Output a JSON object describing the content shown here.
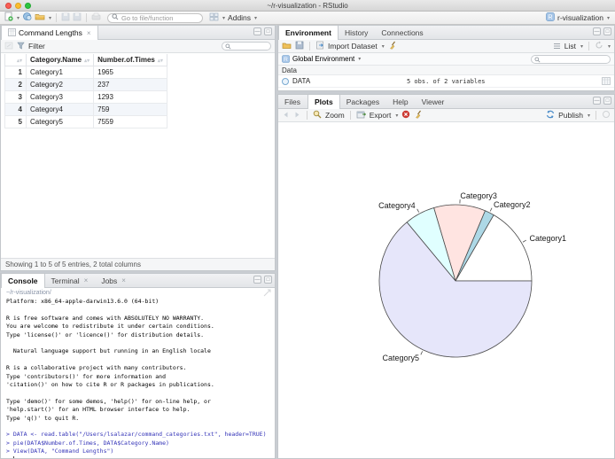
{
  "window": {
    "title": "~/r-visualization - RStudio"
  },
  "toolbar": {
    "goto_placeholder": "Go to file/function",
    "addins_label": "Addins",
    "project_label": "r-visualization"
  },
  "viewer": {
    "tab_label": "Command Lengths",
    "filter_label": "Filter",
    "columns": [
      "Category.Name",
      "Number.of.Times"
    ],
    "rows": [
      [
        "Category1",
        "1965"
      ],
      [
        "Category2",
        "237"
      ],
      [
        "Category3",
        "1293"
      ],
      [
        "Category4",
        "759"
      ],
      [
        "Category5",
        "7559"
      ]
    ],
    "status": "Showing 1 to 5 of 5 entries, 2 total columns"
  },
  "console": {
    "tabs": [
      "Console",
      "Terminal",
      "Jobs"
    ],
    "path": "~/r-visualization/",
    "prompt": "> ",
    "lines": [
      {
        "text": "Platform: x86_64-apple-darwin13.6.0 (64-bit)",
        "type": "output"
      },
      {
        "text": "",
        "type": "output"
      },
      {
        "text": "R is free software and comes with ABSOLUTELY NO WARRANTY.",
        "type": "output"
      },
      {
        "text": "You are welcome to redistribute it under certain conditions.",
        "type": "output"
      },
      {
        "text": "Type 'license()' or 'licence()' for distribution details.",
        "type": "output"
      },
      {
        "text": "",
        "type": "output"
      },
      {
        "text": "  Natural language support but running in an English locale",
        "type": "output"
      },
      {
        "text": "",
        "type": "output"
      },
      {
        "text": "R is a collaborative project with many contributors.",
        "type": "output"
      },
      {
        "text": "Type 'contributors()' for more information and",
        "type": "output"
      },
      {
        "text": "'citation()' on how to cite R or R packages in publications.",
        "type": "output"
      },
      {
        "text": "",
        "type": "output"
      },
      {
        "text": "Type 'demo()' for some demos, 'help()' for on-line help, or",
        "type": "output"
      },
      {
        "text": "'help.start()' for an HTML browser interface to help.",
        "type": "output"
      },
      {
        "text": "Type 'q()' to quit R.",
        "type": "output"
      },
      {
        "text": "",
        "type": "output"
      },
      {
        "text": "> DATA <- read.table(\"/Users/lsalazar/command_categories.txt\", header=TRUE)",
        "type": "command"
      },
      {
        "text": "> pie(DATA$Number.of.Times, DATA$Category.Name)",
        "type": "command"
      },
      {
        "text": "> View(DATA, \"Command Lengths\")",
        "type": "command"
      }
    ]
  },
  "environment": {
    "tabs": [
      "Environment",
      "History",
      "Connections"
    ],
    "import_label": "Import Dataset",
    "list_label": "List",
    "scope_label": "Global Environment",
    "section_label": "Data",
    "objects": [
      {
        "name": "DATA",
        "desc": "5 obs. of 2 variables"
      }
    ]
  },
  "plots": {
    "tabs": [
      "Files",
      "Plots",
      "Packages",
      "Help",
      "Viewer"
    ],
    "zoom_label": "Zoom",
    "export_label": "Export",
    "publish_label": "Publish"
  },
  "chart_data": {
    "type": "pie",
    "categories": [
      "Category1",
      "Category2",
      "Category3",
      "Category4",
      "Category5"
    ],
    "values": [
      1965,
      237,
      1293,
      759,
      7559
    ],
    "colors": [
      "#FFFFFF",
      "#ADD8E6",
      "#FFE4E1",
      "#E0FFFF",
      "#E6E6FA"
    ],
    "slice_border_color": "#4a4a4a",
    "start_angle_deg": 0,
    "direction": "counterclockwise",
    "title": "",
    "legend": false
  }
}
